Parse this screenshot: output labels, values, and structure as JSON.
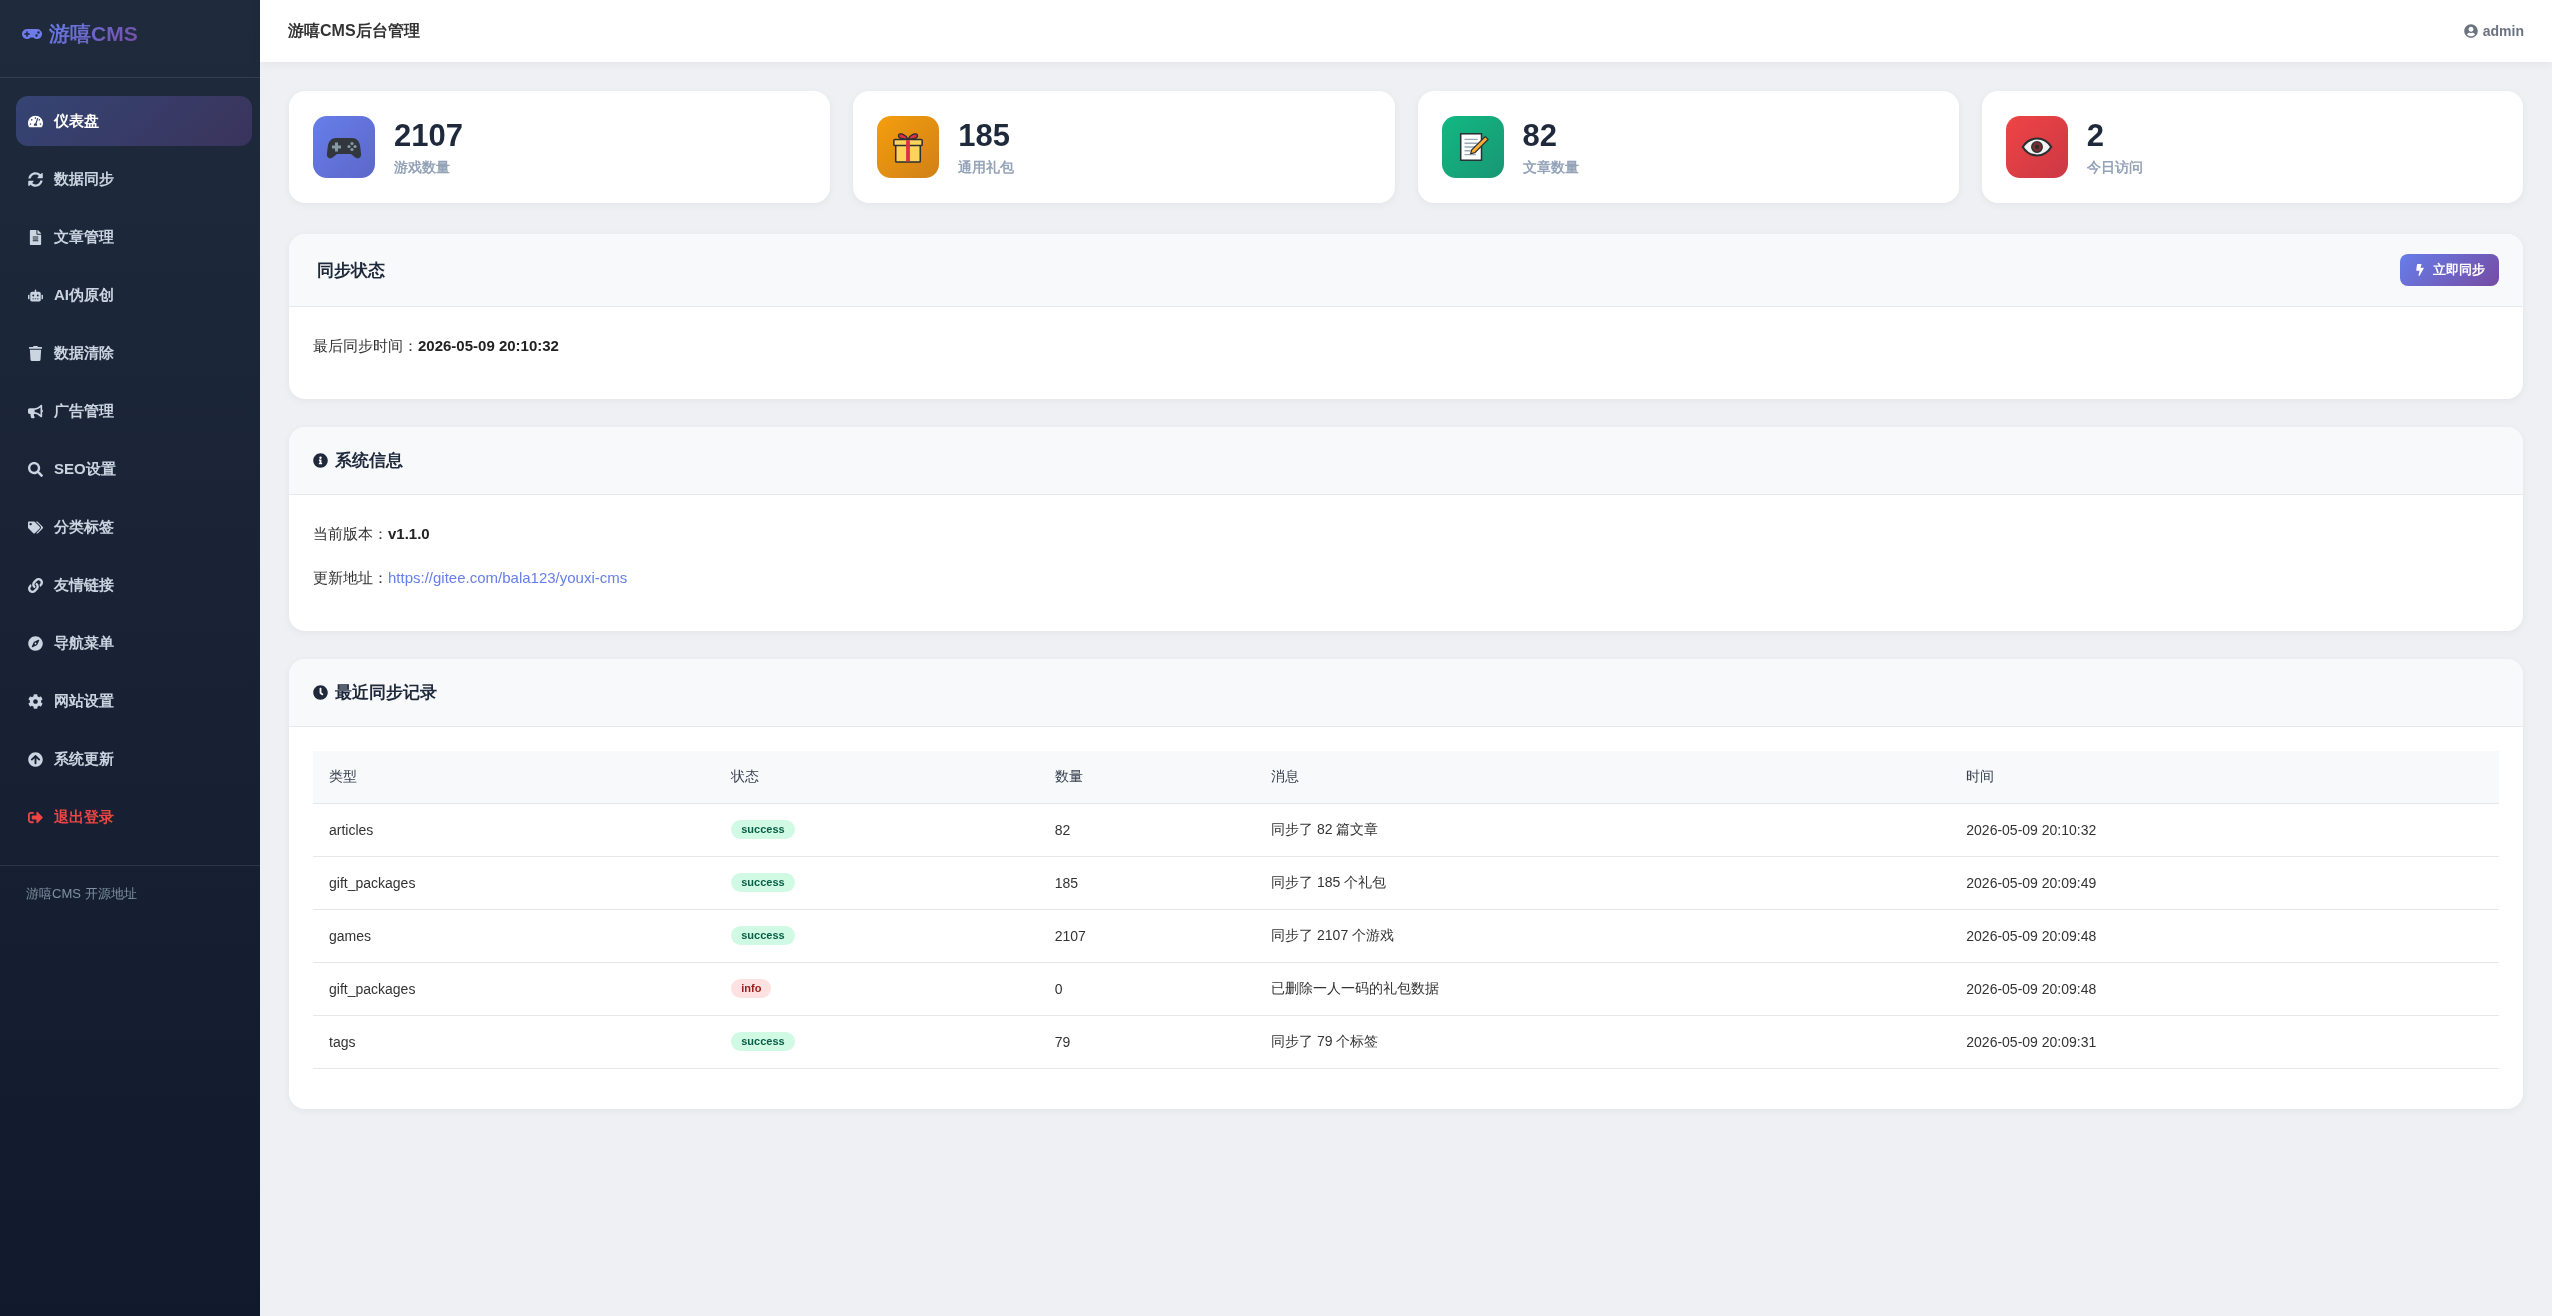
{
  "sidebar": {
    "logo": "游嘻CMS",
    "items": [
      {
        "label": "仪表盘",
        "selected": true,
        "kind": "page"
      },
      {
        "label": "数据同步",
        "selected": false,
        "kind": "page"
      },
      {
        "label": "文章管理",
        "selected": false,
        "kind": "page"
      },
      {
        "label": "AI伪原创",
        "selected": false,
        "kind": "page"
      },
      {
        "label": "数据清除",
        "selected": false,
        "kind": "page"
      },
      {
        "label": "广告管理",
        "selected": false,
        "kind": "page"
      },
      {
        "label": "SEO设置",
        "selected": false,
        "kind": "page"
      },
      {
        "label": "分类标签",
        "selected": false,
        "kind": "page"
      },
      {
        "label": "友情链接",
        "selected": false,
        "kind": "page"
      },
      {
        "label": "导航菜单",
        "selected": false,
        "kind": "page"
      },
      {
        "label": "网站设置",
        "selected": false,
        "kind": "page"
      },
      {
        "label": "系统更新",
        "selected": false,
        "kind": "page"
      },
      {
        "label": "退出登录",
        "selected": false,
        "kind": "logout"
      }
    ],
    "footer_link": "游嘻CMS 开源地址"
  },
  "header": {
    "title": "游嘻CMS后台管理",
    "user": "admin"
  },
  "stats": [
    {
      "value": "2107",
      "label": "游戏数量",
      "color": "#667eea"
    },
    {
      "value": "185",
      "label": "通用礼包",
      "color": "#f59e0b"
    },
    {
      "value": "82",
      "label": "文章数量",
      "color": "#10b981"
    },
    {
      "value": "2",
      "label": "今日访问",
      "color": "#ef4444"
    }
  ],
  "sync_status": {
    "title": "同步状态",
    "button": "立即同步",
    "label": "最后同步时间：",
    "value": "2026-05-09 20:10:32"
  },
  "system_info": {
    "title": "系统信息",
    "version_label": "当前版本：",
    "version": "v1.1.0",
    "update_label": "更新地址：",
    "update_url": "https://gitee.com/bala123/youxi-cms"
  },
  "recent_syncs": {
    "title": "最近同步记录",
    "table": {
      "columns": [
        "类型",
        "状态",
        "数量",
        "消息",
        "时间"
      ],
      "rows": [
        {
          "type": "articles",
          "status": {
            "label": "success",
            "kind": "success"
          },
          "count": "82",
          "message": "同步了 82 篇文章",
          "time": "2026-05-09 20:10:32"
        },
        {
          "type": "gift_packages",
          "status": {
            "label": "success",
            "kind": "success"
          },
          "count": "185",
          "message": "同步了 185 个礼包",
          "time": "2026-05-09 20:09:49"
        },
        {
          "type": "games",
          "status": {
            "label": "success",
            "kind": "success"
          },
          "count": "2107",
          "message": "同步了 2107 个游戏",
          "time": "2026-05-09 20:09:48"
        },
        {
          "type": "gift_packages",
          "status": {
            "label": "info",
            "kind": "info"
          },
          "count": "0",
          "message": "已删除一人一码的礼包数据",
          "time": "2026-05-09 20:09:48"
        },
        {
          "type": "tags",
          "status": {
            "label": "success",
            "kind": "success"
          },
          "count": "79",
          "message": "同步了 79 个标签",
          "time": "2026-05-09 20:09:31"
        }
      ]
    }
  }
}
